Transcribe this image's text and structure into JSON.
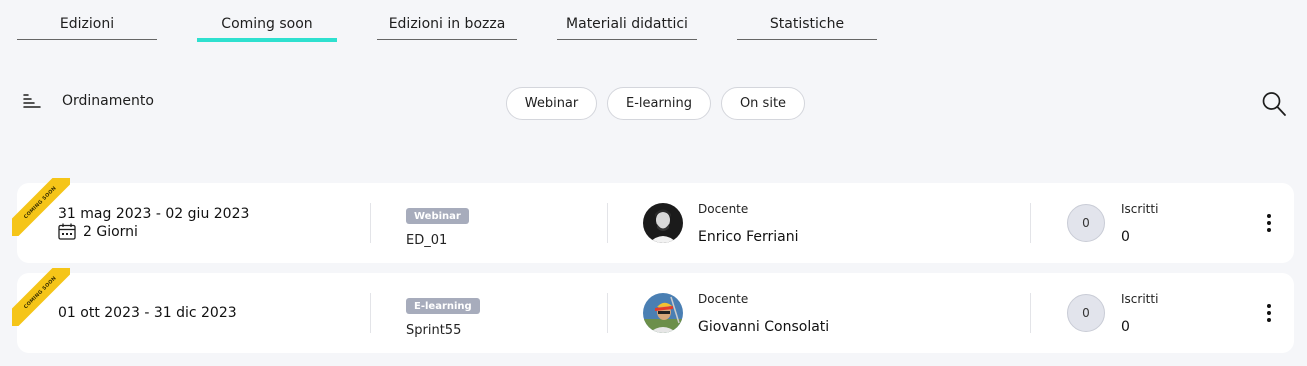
{
  "tabs": [
    {
      "label": "Edizioni",
      "active": false
    },
    {
      "label": "Coming soon",
      "active": true
    },
    {
      "label": "Edizioni in bozza",
      "active": false
    },
    {
      "label": "Materiali didattici",
      "active": false
    },
    {
      "label": "Statistiche",
      "active": false
    }
  ],
  "toolbar": {
    "sort_label": "Ordinamento",
    "sort_icon": "sort-icon",
    "filters": [
      "Webinar",
      "E-learning",
      "On site"
    ],
    "search_icon": "search-icon"
  },
  "colors": {
    "accent": "#2ee0cf",
    "ribbon": "#f5c518",
    "badge": "#a7acbc",
    "background": "#f5f6f9"
  },
  "editions": [
    {
      "ribbon": "COMING SOON",
      "dates": "31 mag 2023 - 02 giu 2023",
      "duration": "2 Giorni",
      "type": "Webinar",
      "code": "ED_01",
      "teacher_label": "Docente",
      "teacher_name": "Enrico Ferriani",
      "enrolled_count": "0",
      "enrolled_label": "Iscritti",
      "enrolled_value": "0"
    },
    {
      "ribbon": "COMING SOON",
      "dates": "01 ott 2023 - 31 dic 2023",
      "type": "E-learning",
      "code": "Sprint55",
      "teacher_label": "Docente",
      "teacher_name": "Giovanni Consolati",
      "enrolled_count": "0",
      "enrolled_label": "Iscritti",
      "enrolled_value": "0"
    }
  ]
}
